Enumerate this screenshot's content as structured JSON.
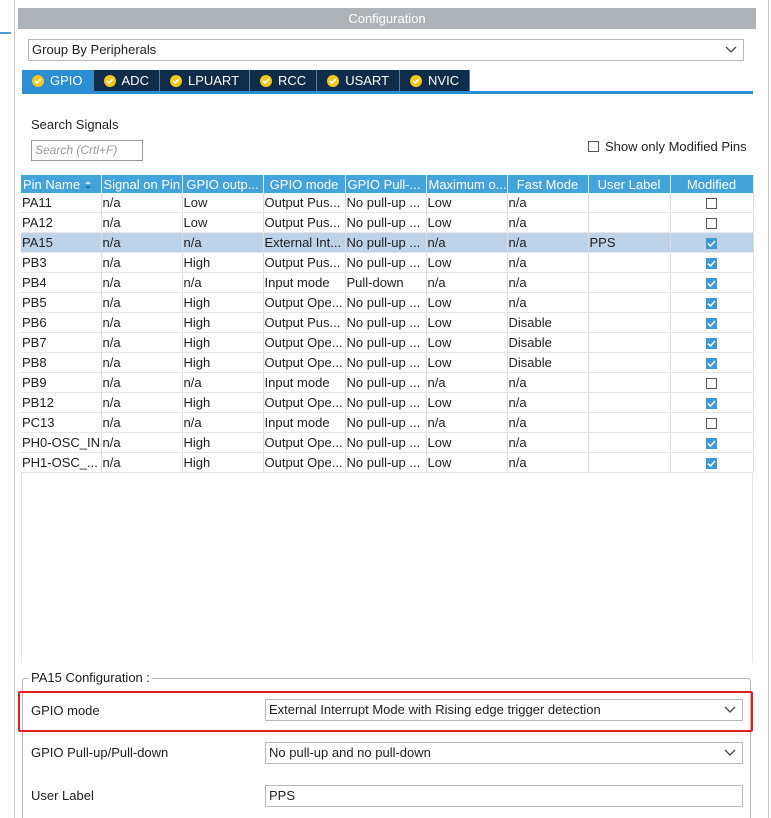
{
  "panel": {
    "title": "Configuration"
  },
  "group_select": {
    "value": "Group By Peripherals"
  },
  "tabs": [
    {
      "label": "GPIO",
      "active": true
    },
    {
      "label": "ADC",
      "active": false
    },
    {
      "label": "LPUART",
      "active": false
    },
    {
      "label": "RCC",
      "active": false
    },
    {
      "label": "USART",
      "active": false
    },
    {
      "label": "NVIC",
      "active": false
    }
  ],
  "search": {
    "label": "Search Signals",
    "placeholder": "Search (Crtl+F)"
  },
  "show_modified": {
    "label": "Show only Modified Pins",
    "checked": false
  },
  "table": {
    "columns": [
      "Pin Name",
      "Signal on Pin",
      "GPIO outp...",
      "GPIO mode",
      "GPIO Pull-...",
      "Maximum o...",
      "Fast Mode",
      "User Label",
      "Modified"
    ],
    "rows": [
      {
        "pin": "PA11",
        "signal": "n/a",
        "output": "Low",
        "mode": "Output Pus...",
        "pull": "No pull-up ...",
        "max": "Low",
        "fast": "n/a",
        "label": "",
        "modified": false,
        "selected": false
      },
      {
        "pin": "PA12",
        "signal": "n/a",
        "output": "Low",
        "mode": "Output Pus...",
        "pull": "No pull-up ...",
        "max": "Low",
        "fast": "n/a",
        "label": "",
        "modified": false,
        "selected": false
      },
      {
        "pin": "PA15",
        "signal": "n/a",
        "output": "n/a",
        "mode": "External Int...",
        "pull": "No pull-up ...",
        "max": "n/a",
        "fast": "n/a",
        "label": "PPS",
        "modified": true,
        "selected": true
      },
      {
        "pin": "PB3",
        "signal": "n/a",
        "output": "High",
        "mode": "Output Pus...",
        "pull": "No pull-up ...",
        "max": "Low",
        "fast": "n/a",
        "label": "",
        "modified": true,
        "selected": false
      },
      {
        "pin": "PB4",
        "signal": "n/a",
        "output": "n/a",
        "mode": "Input mode",
        "pull": "Pull-down",
        "max": "n/a",
        "fast": "n/a",
        "label": "",
        "modified": true,
        "selected": false
      },
      {
        "pin": "PB5",
        "signal": "n/a",
        "output": "High",
        "mode": "Output Ope...",
        "pull": "No pull-up ...",
        "max": "Low",
        "fast": "n/a",
        "label": "",
        "modified": true,
        "selected": false
      },
      {
        "pin": "PB6",
        "signal": "n/a",
        "output": "High",
        "mode": "Output Pus...",
        "pull": "No pull-up ...",
        "max": "Low",
        "fast": "Disable",
        "label": "",
        "modified": true,
        "selected": false
      },
      {
        "pin": "PB7",
        "signal": "n/a",
        "output": "High",
        "mode": "Output Ope...",
        "pull": "No pull-up ...",
        "max": "Low",
        "fast": "Disable",
        "label": "",
        "modified": true,
        "selected": false
      },
      {
        "pin": "PB8",
        "signal": "n/a",
        "output": "High",
        "mode": "Output Ope...",
        "pull": "No pull-up ...",
        "max": "Low",
        "fast": "Disable",
        "label": "",
        "modified": true,
        "selected": false
      },
      {
        "pin": "PB9",
        "signal": "n/a",
        "output": "n/a",
        "mode": "Input mode",
        "pull": "No pull-up ...",
        "max": "n/a",
        "fast": "n/a",
        "label": "",
        "modified": false,
        "selected": false
      },
      {
        "pin": "PB12",
        "signal": "n/a",
        "output": "High",
        "mode": "Output Ope...",
        "pull": "No pull-up ...",
        "max": "Low",
        "fast": "n/a",
        "label": "",
        "modified": true,
        "selected": false
      },
      {
        "pin": "PC13",
        "signal": "n/a",
        "output": "n/a",
        "mode": "Input mode",
        "pull": "No pull-up ...",
        "max": "n/a",
        "fast": "n/a",
        "label": "",
        "modified": false,
        "selected": false
      },
      {
        "pin": "PH0-OSC_IN",
        "signal": "n/a",
        "output": "High",
        "mode": "Output Ope...",
        "pull": "No pull-up ...",
        "max": "Low",
        "fast": "n/a",
        "label": "",
        "modified": true,
        "selected": false
      },
      {
        "pin": "PH1-OSC_...",
        "signal": "n/a",
        "output": "High",
        "mode": "Output Ope...",
        "pull": "No pull-up ...",
        "max": "Low",
        "fast": "n/a",
        "label": "",
        "modified": true,
        "selected": false
      }
    ]
  },
  "config": {
    "title": "PA15 Configuration :",
    "gpio_mode_label": "GPIO mode",
    "gpio_mode_value": "External Interrupt Mode with Rising edge trigger detection",
    "pull_label": "GPIO Pull-up/Pull-down",
    "pull_value": "No pull-up and no pull-down",
    "user_label_label": "User Label",
    "user_label_value": "PPS"
  },
  "colors": {
    "tab_bg": "#0f2d4a",
    "tab_active": "#2b8ed3",
    "header_bg": "#43a4dc",
    "selected_row": "#bcd3ea",
    "highlight": "#e02020"
  }
}
